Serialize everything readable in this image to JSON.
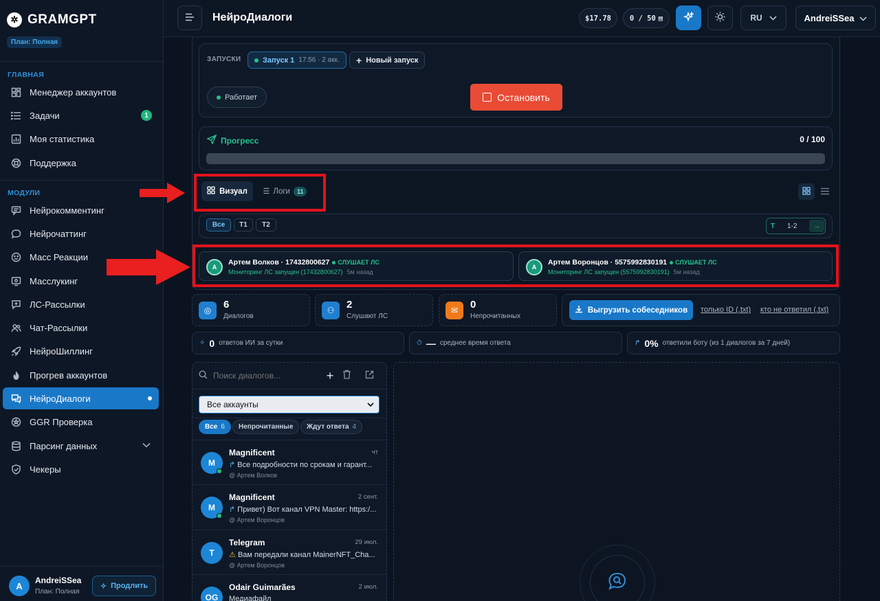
{
  "brand": {
    "name": "GRAMGPT",
    "plan": "План: Полная"
  },
  "sidebar": {
    "section_main": "ГЛАВНАЯ",
    "main_items": [
      {
        "label": "Менеджер аккаунтов",
        "icon": "grid-icon"
      },
      {
        "label": "Задачи",
        "icon": "list-icon",
        "badge": "1"
      },
      {
        "label": "Моя статистика",
        "icon": "chart-icon"
      },
      {
        "label": "Поддержка",
        "icon": "lifebuoy-icon"
      }
    ],
    "section_modules": "МОДУЛИ",
    "module_items": [
      {
        "label": "Нейрокомментинг",
        "icon": "comments-icon"
      },
      {
        "label": "Нейрочаттинг",
        "icon": "chat-bubble-icon"
      },
      {
        "label": "Масс Реакции",
        "icon": "smile-icon"
      },
      {
        "label": "Масслукинг",
        "icon": "monitor-eye-icon"
      },
      {
        "label": "ЛС-Рассылки",
        "icon": "message-plus-icon"
      },
      {
        "label": "Чат-Рассылки",
        "icon": "users-icon"
      },
      {
        "label": "НейроШиллинг",
        "icon": "rocket-icon"
      },
      {
        "label": "Прогрев аккаунтов",
        "icon": "flame-icon"
      },
      {
        "label": "НейроДиалоги",
        "icon": "dialogs-icon",
        "active": true
      },
      {
        "label": "GGR Проверка",
        "icon": "star-badge-icon"
      },
      {
        "label": "Парсинг данных",
        "icon": "database-icon"
      },
      {
        "label": "Чекеры",
        "icon": "shield-check-icon"
      }
    ],
    "user": {
      "initial": "A",
      "name": "AndreiSSea",
      "plan": "План: Полная",
      "extend_label": "Продлить"
    }
  },
  "header": {
    "title": "НейроДиалоги",
    "balance": "$17.78",
    "quota": "0 / 50",
    "lang": "RU",
    "account": "AndreiSSea"
  },
  "runs": {
    "label": "ЗАПУСКИ",
    "run_name": "Запуск 1",
    "run_meta": "17:56 · 2 акк.",
    "new_run": "Новый запуск",
    "status": "Работает",
    "stop": "Остановить"
  },
  "progress": {
    "label": "Прогресс",
    "value": "0 / 100",
    "fraction": 0
  },
  "tabs": {
    "visual": "Визуал",
    "logs": "Логи",
    "logs_count": "11"
  },
  "filters": {
    "all": "Все",
    "t1": "T1",
    "t2": "T2",
    "page_prefix": "T",
    "page_range": "1-2"
  },
  "accounts": [
    {
      "initial": "A",
      "title": "Артем Волков · 17432800627",
      "status": "СЛУШАЕТ ЛС",
      "sub": "Мониторинг ЛС запущен (17432800627)",
      "ago": "5м назад"
    },
    {
      "initial": "A",
      "title": "Артем Воронцов · 5575992830191",
      "status": "СЛУШАЕТ ЛС",
      "sub": "Мониторинг ЛС запущен (5575992830191)",
      "ago": "5м назад"
    }
  ],
  "stats": [
    {
      "value": "6",
      "label": "Диалогов",
      "color": "#1f7fd0"
    },
    {
      "value": "2",
      "label": "Слушают ЛС",
      "color": "#1f7fd0"
    },
    {
      "value": "0",
      "label": "Непрочитанных",
      "color": "#f07a1a"
    }
  ],
  "export": {
    "button": "Выгрузить собеседников",
    "link1": "только ID (.txt)",
    "link2": "кто не ответил (.txt)"
  },
  "metrics": [
    {
      "value": "0",
      "label": "ответов ИИ за сутки"
    },
    {
      "value": "—",
      "label": "среднее время ответа"
    },
    {
      "value": "0%",
      "label": "ответили боту (из 1 диалогов за 7 дней)"
    }
  ],
  "dialogs_panel": {
    "search_placeholder": "Поиск диалогов...",
    "account_select": "Все аккаунты",
    "filters": [
      {
        "label": "Все",
        "count": "6",
        "selected": true
      },
      {
        "label": "Непрочитанные",
        "count": ""
      },
      {
        "label": "Ждут ответа",
        "count": "4"
      }
    ],
    "items": [
      {
        "initial": "M",
        "name": "Magnificent",
        "time": "чт",
        "msg": "Все подробности по срокам и гарант...",
        "msg_icon": "reply-icon",
        "account": "@ Артем Волков",
        "online": true
      },
      {
        "initial": "M",
        "name": "Magnificent",
        "time": "2 сент.",
        "msg": "Привет) Вот канал VPN Master: https:/...",
        "msg_icon": "reply-icon",
        "account": "@ Артем Воронцов",
        "online": true
      },
      {
        "initial": "T",
        "name": "Telegram",
        "time": "29 июл.",
        "msg": "Вам передали канал MainerNFT_Cha...",
        "msg_icon": "warning-icon",
        "account": "@ Артем Воронцов",
        "online": false
      },
      {
        "initial": "OG",
        "name": "Odair Guimarães",
        "time": "2 июл.",
        "msg": "Медиафайл",
        "msg_icon": "",
        "account": "",
        "online": false
      }
    ]
  }
}
